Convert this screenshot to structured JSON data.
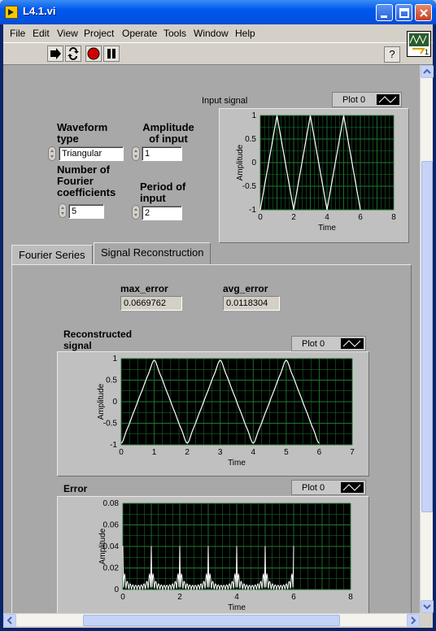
{
  "window": {
    "title": "L4.1.vi"
  },
  "menu": [
    "File",
    "Edit",
    "View",
    "Project",
    "Operate",
    "Tools",
    "Window",
    "Help"
  ],
  "vi_icon_label": "1",
  "controls": {
    "waveform_type": {
      "label": "Waveform type",
      "value": "Triangular"
    },
    "amplitude": {
      "label": "Amplitude of input",
      "value": "1"
    },
    "num_coeffs": {
      "label": "Number of Fourier coefficients",
      "value": "5"
    },
    "period": {
      "label": "Period of input",
      "value": "2"
    }
  },
  "tabs": [
    {
      "label": "Fourier Series",
      "active": false
    },
    {
      "label": "Signal Reconstruction",
      "active": true
    }
  ],
  "indicators": {
    "max_error": {
      "label": "max_error",
      "value": "0.0669762"
    },
    "avg_error": {
      "label": "avg_error",
      "value": "0.0118304"
    }
  },
  "chart_data": [
    {
      "type": "line",
      "title": "Input signal",
      "legend": "Plot 0",
      "xlabel": "Time",
      "ylabel": "Amplitude",
      "xlim": [
        0,
        8
      ],
      "ylim": [
        -1,
        1
      ],
      "xticks": [
        "0",
        "2",
        "4",
        "6",
        "8"
      ],
      "yticks": [
        "1",
        "0.5",
        "0",
        "-0.5",
        "-1"
      ],
      "series": [
        {
          "x": [
            0,
            1,
            2,
            3,
            4,
            5,
            6
          ],
          "y": [
            -1,
            1,
            -1,
            1,
            -1,
            1,
            -1
          ]
        }
      ],
      "plot_bg": "#000000",
      "grid_color": "#1f7a30",
      "line_color": "#ffffff"
    },
    {
      "type": "line",
      "title": "Reconstructed signal",
      "legend": "Plot 0",
      "xlabel": "Time",
      "ylabel": "Amplitude",
      "xlim": [
        0,
        7
      ],
      "ylim": [
        -1,
        1
      ],
      "xticks": [
        "0",
        "1",
        "2",
        "3",
        "4",
        "5",
        "6",
        "7"
      ],
      "yticks": [
        "1",
        "0.5",
        "0",
        "-0.5",
        "-1"
      ],
      "series": [
        {
          "x": [
            0,
            1,
            2,
            3,
            4,
            5,
            6
          ],
          "y": [
            -0.93,
            0.93,
            -0.93,
            0.93,
            -0.93,
            0.93,
            -0.93
          ],
          "kind": "fourier_triangle"
        }
      ],
      "plot_bg": "#000000",
      "grid_color": "#1f7a30",
      "line_color": "#ffffff"
    },
    {
      "type": "line",
      "title": "Error",
      "legend": "Plot 0",
      "xlabel": "Time",
      "ylabel": "Amplitude",
      "xlim": [
        0,
        8
      ],
      "ylim": [
        0,
        0.08
      ],
      "xticks": [
        "0",
        "2",
        "4",
        "6",
        "8"
      ],
      "yticks": [
        "0.08",
        "0.06",
        "0.04",
        "0.02",
        "0"
      ],
      "series": [
        {
          "x_range": [
            0,
            6
          ],
          "peak_times": [
            0,
            1,
            2,
            3,
            4,
            5,
            6
          ],
          "peak": 0.067,
          "kind": "fourier_error"
        }
      ],
      "plot_bg": "#000000",
      "grid_color": "#1f7a30",
      "line_color": "#ffffff"
    }
  ]
}
